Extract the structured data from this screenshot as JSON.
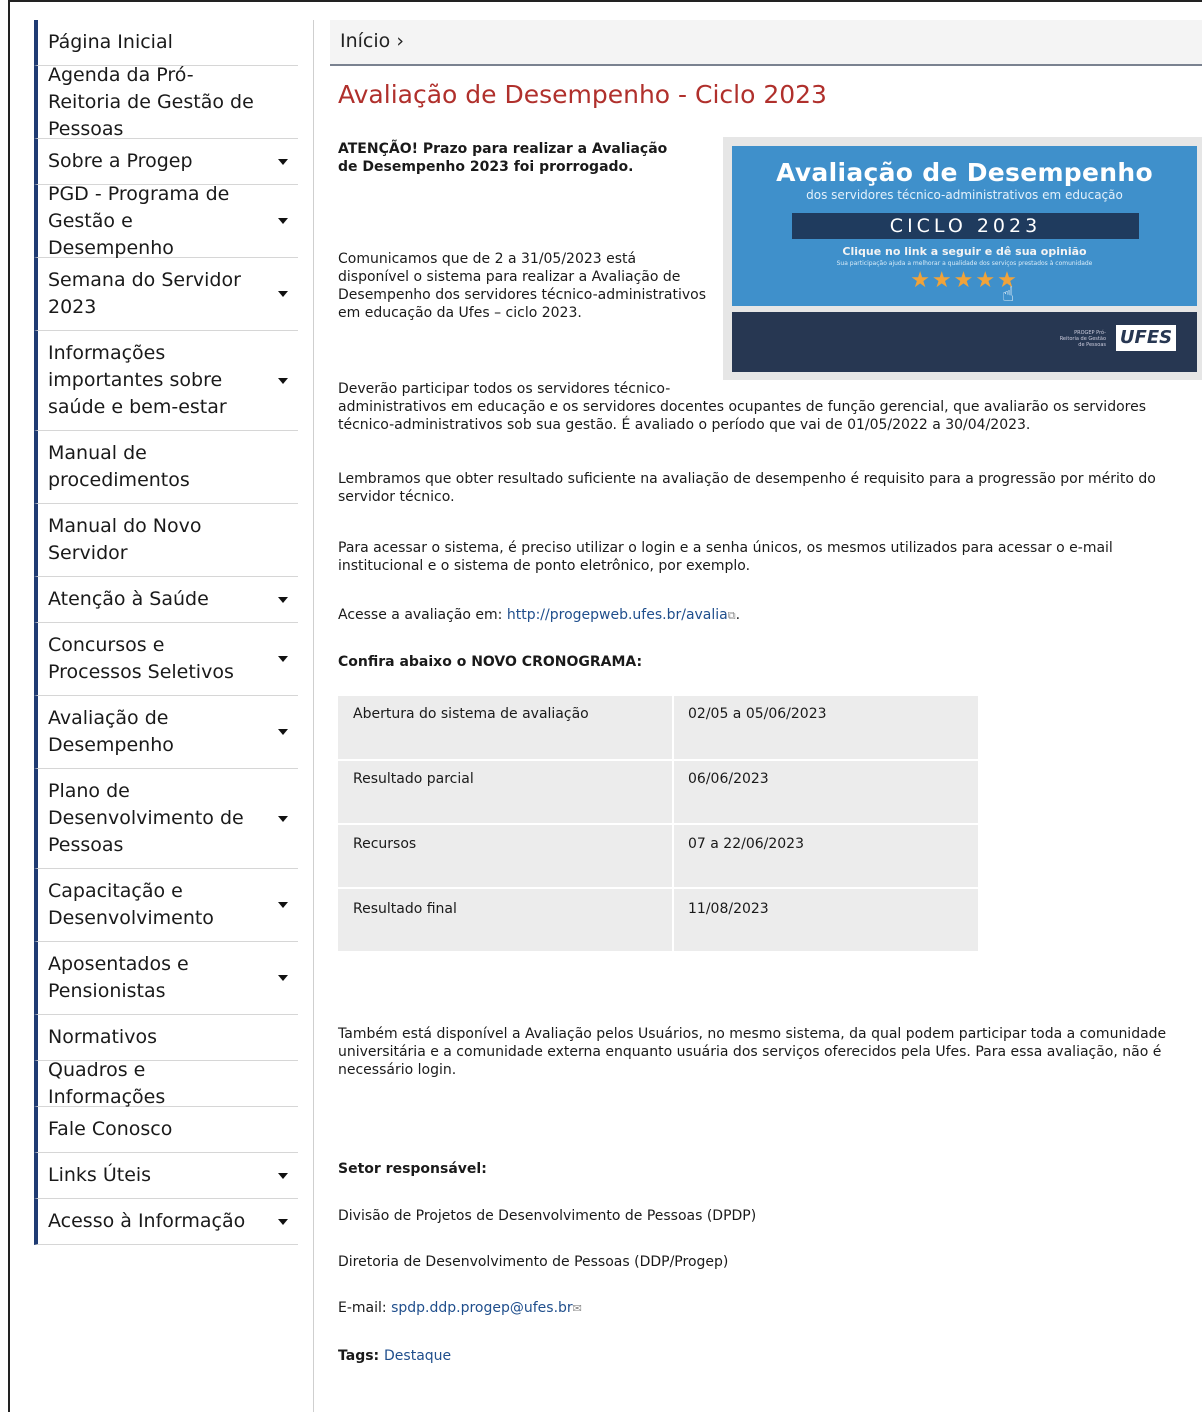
{
  "sidebar": {
    "items": [
      {
        "label": "Página Inicial",
        "caret": false
      },
      {
        "label": "Agenda da Pró-Reitoria de Gestão de Pessoas",
        "caret": false
      },
      {
        "label": "Sobre a Progep",
        "caret": true
      },
      {
        "label": "PGD - Programa de Gestão e Desempenho",
        "caret": true
      },
      {
        "label": "Semana do Servidor 2023",
        "caret": true
      },
      {
        "label": "Informações importantes sobre saúde e bem-estar",
        "caret": true
      },
      {
        "label": "Manual de procedimentos",
        "caret": false
      },
      {
        "label": "Manual do Novo Servidor",
        "caret": false
      },
      {
        "label": "Atenção à Saúde",
        "caret": true
      },
      {
        "label": "Concursos e Processos Seletivos",
        "caret": true
      },
      {
        "label": "Avaliação de Desempenho",
        "caret": true
      },
      {
        "label": "Plano de Desenvolvimento de Pessoas",
        "caret": true
      },
      {
        "label": "Capacitação e Desenvolvimento",
        "caret": true
      },
      {
        "label": "Aposentados e Pensionistas",
        "caret": true
      },
      {
        "label": "Normativos",
        "caret": false
      },
      {
        "label": "Quadros e Informações",
        "caret": false
      },
      {
        "label": "Fale Conosco",
        "caret": false
      },
      {
        "label": "Links Úteis",
        "caret": true
      },
      {
        "label": "Acesso à Informação",
        "caret": true
      }
    ]
  },
  "breadcrumb": {
    "home": "Início",
    "separator": "›"
  },
  "page": {
    "title": "Avaliação de Desempenho - Ciclo 2023",
    "attention": "ATENÇÃO! Prazo para realizar a Avaliação de Desempenho 2023 foi prorrogado.",
    "intro": "Comunicamos que de 2 a 31/05/2023 está disponível o sistema para realizar a Avaliação de Desempenho dos servidores técnico-administrativos em educação da Ufes – ciclo 2023.",
    "participants_a": "Deverão participar todos os servidores técnico-",
    "participants_b": "administrativos em educação e os servidores docentes ocupantes de função gerencial, que avaliarão os servidores técnico-administrativos sob sua gestão. É avaliado o período que vai de 01/05/2022 a 30/04/2023.",
    "reminder": "Lembramos que obter resultado suficiente na avaliação de desempenho é requisito para a progressão por mérito do servidor técnico.",
    "access": "Para acessar o sistema, é preciso utilizar o login e a senha únicos, os mesmos utilizados para acessar o e-mail institucional e o sistema de ponto eletrônico, por exemplo.",
    "access_link_prefix": "Acesse a avaliação em: ",
    "access_link": "http://progepweb.ufes.br/avalia",
    "access_link_suffix": ".",
    "schedule_heading": "Confira abaixo o NOVO CRONOGRAMA:",
    "users_eval": "Também está disponível a Avaliação pelos Usuários, no mesmo sistema, da qual podem participar toda a comunidade universitária e a comunidade externa enquanto usuária dos serviços oferecidos pela Ufes. Para essa avaliação, não é necessário login.",
    "sector_heading": "Setor responsável:",
    "sector_1": "Divisão de Projetos de Desenvolvimento de Pessoas (DPDP)",
    "sector_2": "Diretoria de Desenvolvimento de Pessoas (DDP/Progep)",
    "email_label": "E-mail: ",
    "email": "spdp.ddp.progep@ufes.br",
    "tags_label": "Tags: ",
    "tag": "Destaque"
  },
  "banner": {
    "title": "Avaliação de Desempenho",
    "subtitle": "dos servidores técnico-administrativos em educação",
    "cycle": "CICLO 2023",
    "cta": "Clique no link a seguir e dê sua opinião",
    "cta_small": "Sua participação ajuda a melhorar a qualidade dos serviços prestados à comunidade",
    "stars": "★★★★★",
    "hand_icon": "☝",
    "progep": "PROGEP Pró-Reitoria de Gestão de Pessoas",
    "logo": "UFES"
  },
  "schedule": {
    "rows": [
      {
        "item": "Abertura do sistema de avaliação",
        "date": "02/05 a 05/06/2023"
      },
      {
        "item": "Resultado parcial",
        "date": "06/06/2023"
      },
      {
        "item": "Recursos",
        "date": "07 a 22/06/2023"
      },
      {
        "item": "Resultado final",
        "date": "11/08/2023"
      }
    ]
  },
  "icons": {
    "external": "⧉",
    "mail": "✉"
  },
  "colors": {
    "title_red": "#b0302c",
    "sidebar_accent": "#1f3b73",
    "link_blue": "#1f4e8c",
    "banner_blue": "#3f90cb"
  }
}
